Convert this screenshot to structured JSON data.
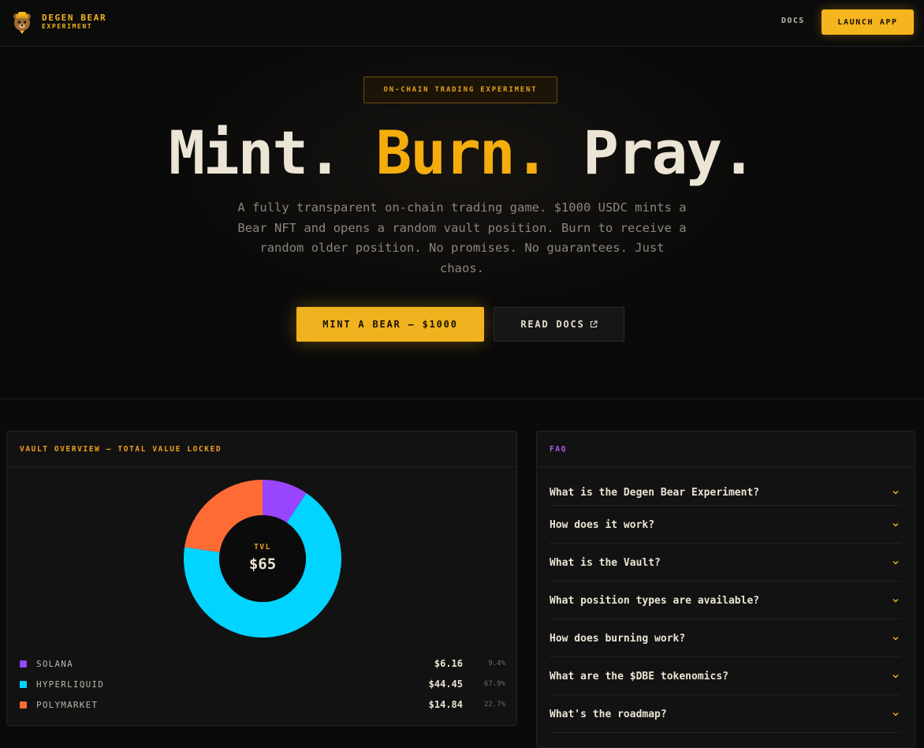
{
  "brand": {
    "name": "DEGEN BEAR",
    "sub": "EXPERIMENT",
    "logo_icon": "bear-icon"
  },
  "nav": {
    "docs": "DOCS",
    "launch": "LAUNCH APP"
  },
  "hero": {
    "badge": "ON-CHAIN TRADING EXPERIMENT",
    "headline": {
      "part1": "Mint. ",
      "part2": "Burn.",
      "part3": " Pray."
    },
    "subtext": "A fully transparent on-chain trading game. $1000 USDC mints a Bear NFT and opens a random vault position. Burn to receive a random older position. No promises. No guarantees. Just chaos.",
    "mint_button": "MINT A BEAR — $1000",
    "docs_button": "READ DOCS"
  },
  "colors": {
    "accent": "#f5b51e",
    "solana": "#9945ff",
    "hyperliquid": "#00d4ff",
    "polymarket": "#ff6b35",
    "faq_label": "#b05ee8"
  },
  "vault": {
    "title": "VAULT OVERVIEW — TOTAL VALUE LOCKED",
    "center_label": "TVL",
    "center_value": "$65",
    "legend": [
      {
        "name": "SOLANA",
        "value": "$6.16",
        "pct": "9.4%"
      },
      {
        "name": "HYPERLIQUID",
        "value": "$44.45",
        "pct": "67.9%"
      },
      {
        "name": "POLYMARKET",
        "value": "$14.84",
        "pct": "22.7%"
      }
    ]
  },
  "chart_data": {
    "type": "pie",
    "categories": [
      "SOLANA",
      "HYPERLIQUID",
      "POLYMARKET"
    ],
    "values": [
      6.16,
      44.45,
      14.84
    ],
    "percent": [
      9.4,
      67.9,
      22.7
    ],
    "colors": [
      "#9945ff",
      "#00d4ff",
      "#ff6b35"
    ],
    "title": "VAULT OVERVIEW — TOTAL VALUE LOCKED",
    "donut": true
  },
  "faq": {
    "title": "FAQ",
    "items": [
      "What is the Degen Bear Experiment?",
      "How does it work?",
      "What is the Vault?",
      "What position types are available?",
      "How does burning work?",
      "What are the $DBE tokenomics?",
      "What's the roadmap?"
    ]
  }
}
